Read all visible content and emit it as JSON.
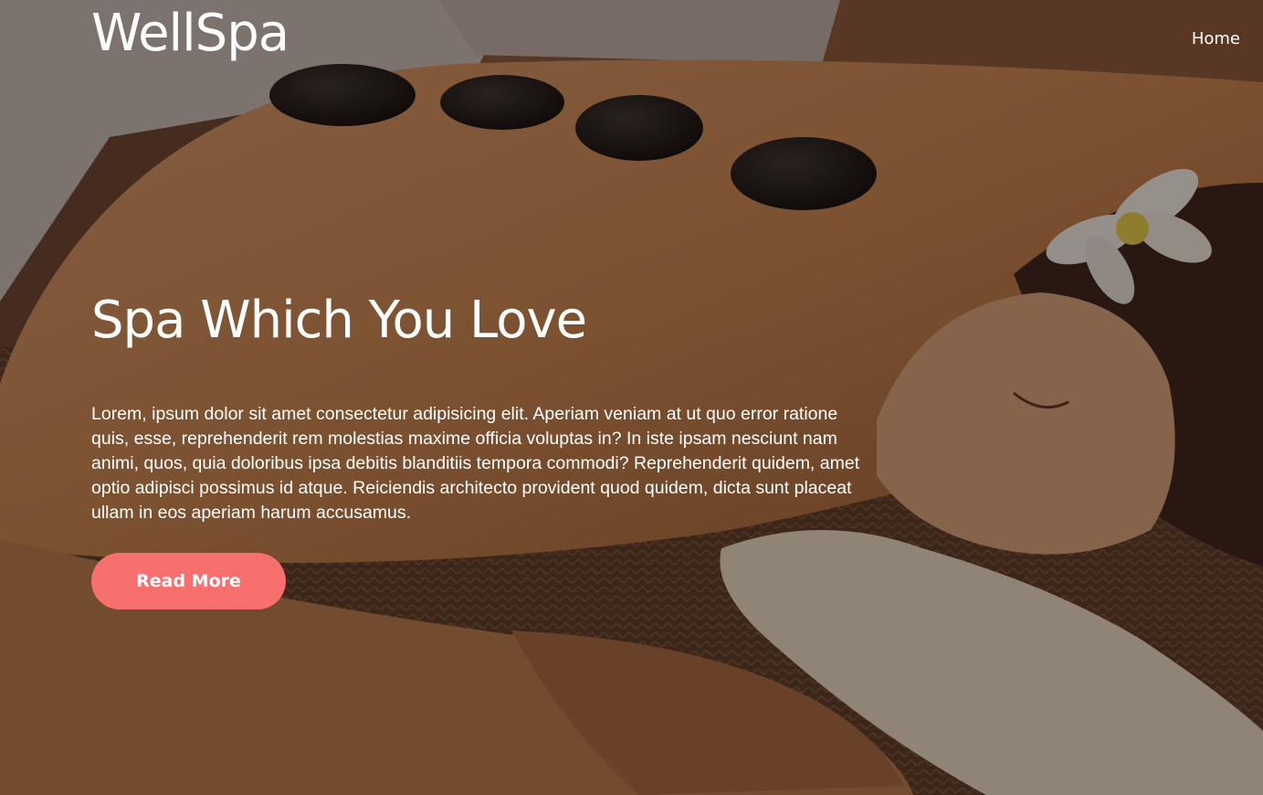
{
  "brand": {
    "logo_text": "WellSpa"
  },
  "nav": {
    "items": [
      {
        "label": "Home"
      }
    ]
  },
  "hero": {
    "headline": "Spa Which You Love",
    "body": "Lorem, ipsum dolor sit amet consectetur adipisicing elit. Aperiam veniam at ut quo error ratione quis, esse, reprehenderit rem molestias maxime officia voluptas in? In iste ipsam nesciunt nam animi, quos, quia doloribus ipsa debitis blanditiis tempora commodi? Reprehenderit quidem, amet optio adipisci possimus id atque. Reiciendis architecto provident quod quidem, dicta sunt placeat ullam in eos aperiam harum accusamus.",
    "cta_label": "Read More"
  },
  "colors": {
    "accent": "#f7706e",
    "text": "#ffffff"
  },
  "icons": {
    "background": "spa-massage-hero-photo"
  }
}
